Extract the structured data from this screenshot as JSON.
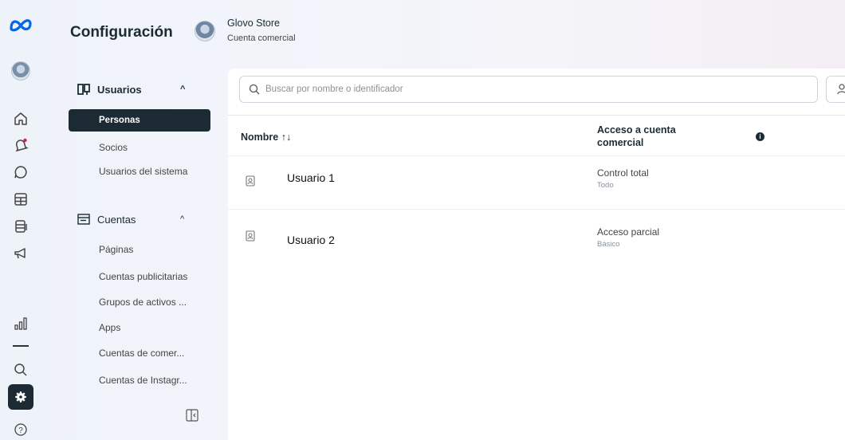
{
  "header": {
    "title": "Configuración",
    "business_name": "Glovo Store",
    "business_type": "Cuenta comercial"
  },
  "rail": {
    "icons": [
      "meta-logo",
      "store-avatar",
      "home-icon",
      "notifications-icon",
      "messages-icon",
      "grid-icon",
      "catalog-icon",
      "ads-megaphone-icon",
      "insights-icon",
      "menu-divider",
      "search-icon",
      "settings-icon",
      "help-icon"
    ],
    "active": "settings-icon"
  },
  "sidebar": {
    "users_section": {
      "label": "Usuarios",
      "icon": "users-icon",
      "items": [
        {
          "label": "Personas",
          "active": true
        },
        {
          "label": "Socios",
          "active": false
        },
        {
          "label": "Usuarios del sistema",
          "active": false
        }
      ]
    },
    "accounts_section": {
      "label": "Cuentas",
      "icon": "accounts-icon",
      "items": [
        {
          "label": "Páginas"
        },
        {
          "label": "Cuentas publicitarias"
        },
        {
          "label": "Grupos de activos ..."
        },
        {
          "label": "Apps"
        },
        {
          "label": "Cuentas de comer..."
        },
        {
          "label": "Cuentas de Instagr..."
        }
      ]
    }
  },
  "main": {
    "search_placeholder": "Buscar por nombre o identificador",
    "columns": {
      "name": "Nombre ↑↓",
      "access": "Acceso a cuenta comercial"
    },
    "rows": [
      {
        "name": "Usuario 1",
        "access": "Control total",
        "level": "Todo"
      },
      {
        "name": "Usuario 2",
        "access": "Acceso parcial",
        "level": "Básico"
      }
    ]
  },
  "colors": {
    "active_bg": "#1c2b33",
    "meta_blue": "#0668e1"
  }
}
